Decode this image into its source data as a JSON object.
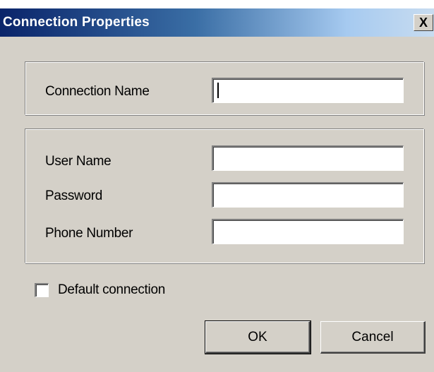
{
  "window": {
    "title": "Connection Properties",
    "close_glyph": "X"
  },
  "connection_group": {
    "name_label": "Connection Name",
    "name_value": ""
  },
  "credentials_group": {
    "user_label": "User Name",
    "user_value": "",
    "password_label": "Password",
    "password_value": "",
    "phone_label": "Phone Number",
    "phone_value": ""
  },
  "options": {
    "default_label": "Default connection",
    "default_checked": false
  },
  "buttons": {
    "ok_label": "OK",
    "cancel_label": "Cancel"
  },
  "colors": {
    "title_start": "#0a246a",
    "title_end": "#a6caf0",
    "face": "#d4d0c8"
  },
  "icons": {
    "close": "close-icon"
  }
}
